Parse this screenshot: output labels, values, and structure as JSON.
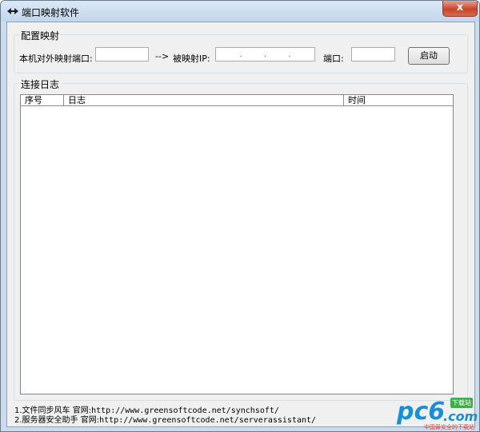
{
  "window": {
    "title": "端口映射软件",
    "close_label": "x"
  },
  "config": {
    "group_title": "配置映射",
    "local_port_label": "本机对外映射端口:",
    "local_port_value": "",
    "arrow_label": "-->",
    "mapped_ip_label": "被映射IP:",
    "ip_separators": [
      ".",
      ".",
      "."
    ],
    "port_label": "端口:",
    "port_value": "",
    "start_button": "启动"
  },
  "log": {
    "group_title": "连接日志",
    "columns": [
      "序号",
      "日志",
      "时间"
    ],
    "rows": []
  },
  "footer": {
    "lines": [
      {
        "num": "1.",
        "text": "文件同步风车 官网:",
        "url": "http://www.greensoftcode.net/synchsoft/"
      },
      {
        "num": "2.",
        "text": "服务器安全助手 官网:",
        "url": "http://www.greensoftcode.net/serverassistant/"
      }
    ]
  },
  "watermark": {
    "brand": "pc6",
    "suffix": ".com",
    "badge": "下载站",
    "slogan": "中国最安全的下载站"
  },
  "colors": {
    "title_bg": "#c9dcf0",
    "close": "#c7442a",
    "brand_blue": "#1a8fd6",
    "brand_green": "#3fae49"
  }
}
